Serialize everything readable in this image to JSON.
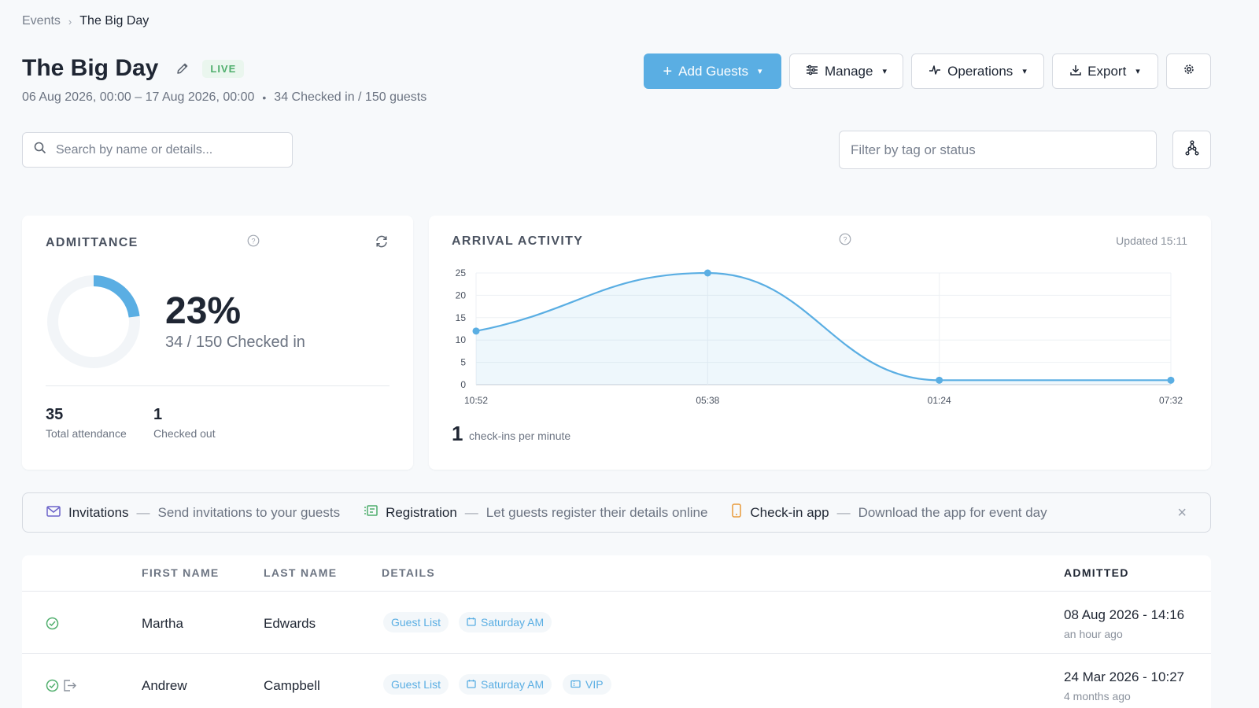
{
  "breadcrumb": {
    "parent": "Events",
    "current": "The Big Day"
  },
  "event": {
    "title": "The Big Day",
    "status_badge": "LIVE",
    "date_range": "06 Aug 2026, 00:00 – 17 Aug 2026, 00:00",
    "checkin_summary": "34 Checked in / 150 guests"
  },
  "toolbar": {
    "add_guests": "Add Guests",
    "manage": "Manage",
    "operations": "Operations",
    "export": "Export"
  },
  "search": {
    "placeholder": "Search by name or details..."
  },
  "filter": {
    "placeholder": "Filter by tag or status"
  },
  "admittance": {
    "label": "ADMITTANCE",
    "percent": "23%",
    "percent_value": 23,
    "checked_in_text": "34 / 150 Checked in",
    "total_attendance_value": "35",
    "total_attendance_label": "Total attendance",
    "checked_out_value": "1",
    "checked_out_label": "Checked out"
  },
  "arrival": {
    "label": "ARRIVAL ACTIVITY",
    "updated": "Updated 15:11",
    "rate_value": "1",
    "rate_label": "check-ins per minute"
  },
  "chart_data": {
    "type": "area",
    "x": [
      "10:52",
      "05:38",
      "01:24",
      "07:32"
    ],
    "series": [
      {
        "values": [
          12,
          25,
          1,
          1
        ]
      }
    ],
    "ylim": [
      0,
      25
    ],
    "yticks": [
      "25",
      "20",
      "15",
      "10",
      "5",
      "0"
    ],
    "grid": true,
    "color": "#5aaee3"
  },
  "banner": {
    "items": [
      {
        "title": "Invitations",
        "desc": "Send invitations to your guests",
        "icon": "envelope-icon",
        "color": "#6b63c9"
      },
      {
        "title": "Registration",
        "desc": "Let guests register their details online",
        "icon": "registration-icon",
        "color": "#4fae6c"
      },
      {
        "title": "Check-in app",
        "desc": "Download the app for event day",
        "icon": "phone-icon",
        "color": "#e89a3a"
      }
    ],
    "close": "×"
  },
  "table": {
    "headers": {
      "first_name": "FIRST NAME",
      "last_name": "LAST NAME",
      "details": "DETAILS",
      "admitted": "ADMITTED"
    },
    "rows": [
      {
        "first": "Martha",
        "last": "Edwards",
        "tags": [
          "Guest List",
          "Saturday AM"
        ],
        "admitted": "08 Aug 2026 - 14:16",
        "admitted_ago": "an hour ago"
      },
      {
        "first": "Andrew",
        "last": "Campbell",
        "tags": [
          "Guest List",
          "Saturday AM",
          "VIP"
        ],
        "admitted": "24 Mar 2026 - 10:27",
        "admitted_ago": "4 months ago"
      }
    ]
  }
}
